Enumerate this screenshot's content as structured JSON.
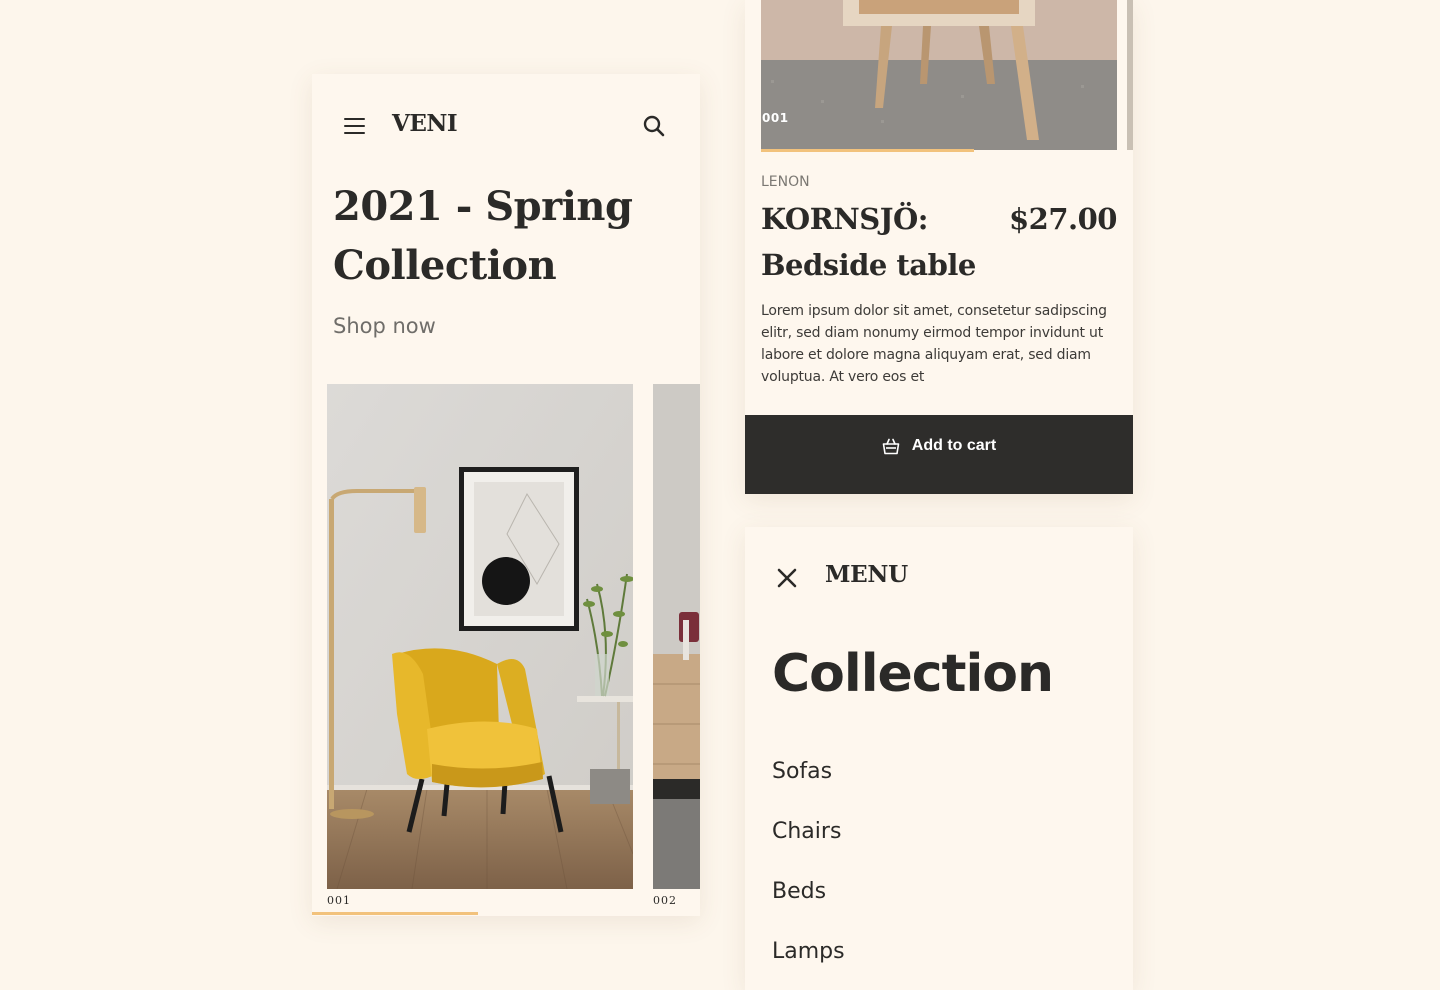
{
  "header": {
    "brand": "VENI"
  },
  "hero": {
    "title": "2021 - Spring Collection",
    "cta": "Shop now"
  },
  "slider": {
    "slides": [
      {
        "number": "001"
      },
      {
        "number": "002"
      }
    ]
  },
  "product": {
    "image_number": "001",
    "brand": "LENON",
    "name": "KORNSJÖ: Bedside table",
    "price": "$27.00",
    "description": "Lorem ipsum dolor sit amet, consetetur sadipscing elitr, sed diam nonumy eirmod tempor invidunt ut labore et dolore magna aliquyam erat, sed diam voluptua. At vero eos et",
    "cart_label": "Add to cart"
  },
  "menu": {
    "title": "MENU",
    "heading": "Collection",
    "items": [
      "Sofas",
      "Chairs",
      "Beds",
      "Lamps"
    ]
  },
  "colors": {
    "background": "#fdf6ec",
    "card": "#fef7ee",
    "accent": "#f2c27c",
    "dark": "#2e2d2b",
    "chair": "#e7b82b"
  },
  "icons": [
    "hamburger-icon",
    "search-icon",
    "basket-icon",
    "close-icon"
  ]
}
